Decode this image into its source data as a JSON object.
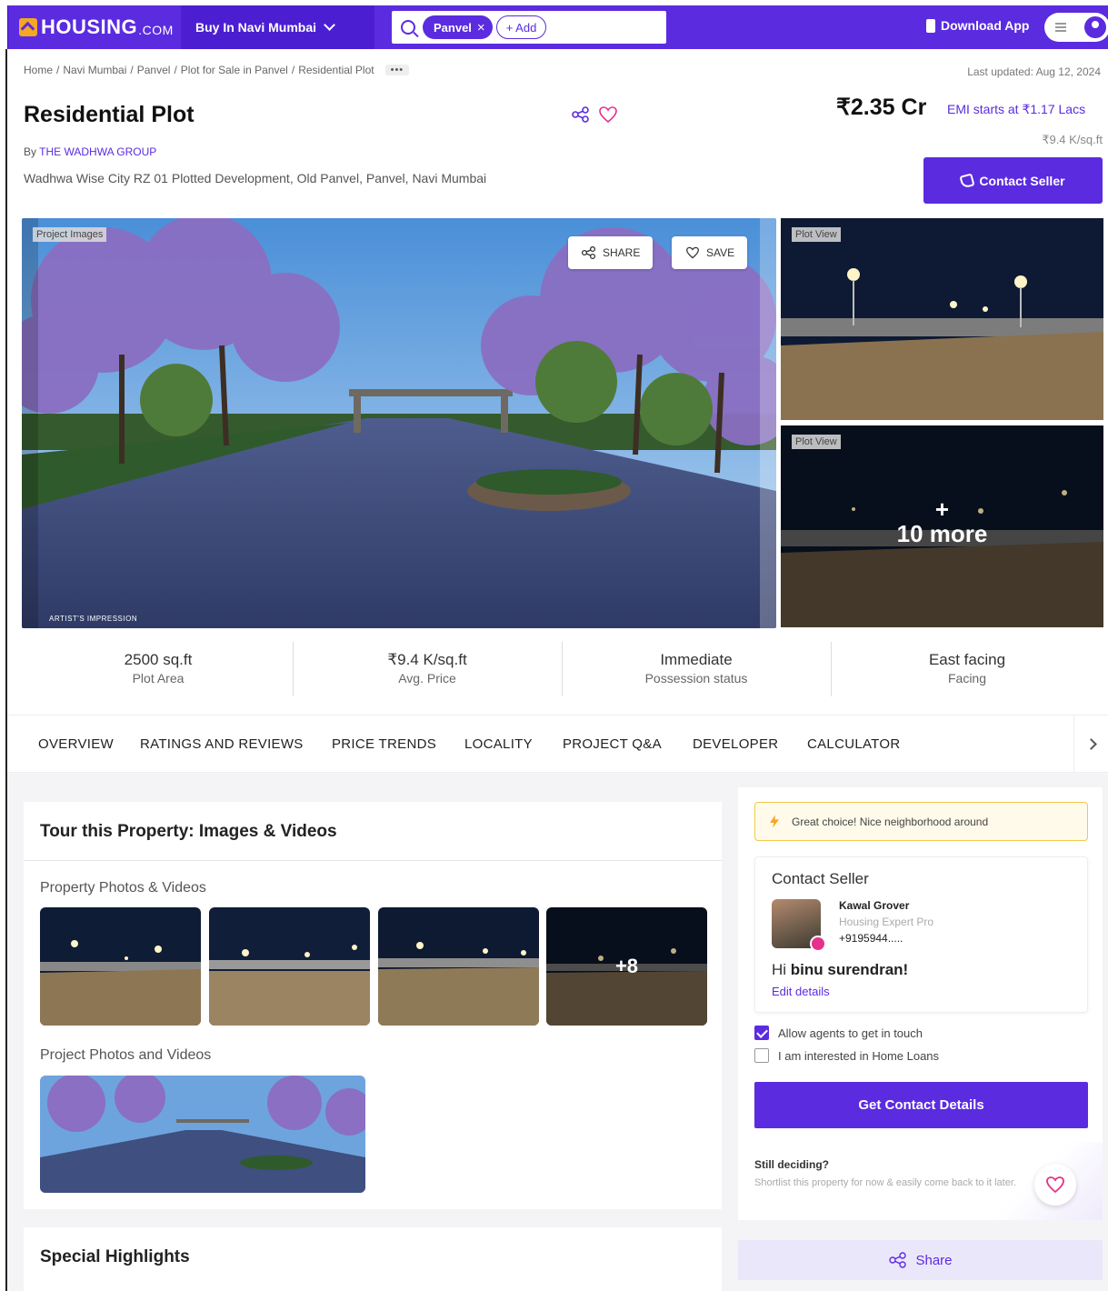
{
  "header": {
    "logo_text": "HOUSING",
    "logo_suffix": ".COM",
    "city_select": "Buy In Navi Mumbai",
    "search_chip": "Panvel",
    "add_chip": "+ Add",
    "download_app": "Download App"
  },
  "breadcrumb": {
    "items": [
      "Home",
      "Navi Mumbai",
      "Panvel",
      "Plot for Sale in Panvel",
      "Residential Plot"
    ],
    "more": "•••"
  },
  "last_updated": "Last updated: Aug 12, 2024",
  "listing": {
    "title": "Residential Plot",
    "by_prefix": "By",
    "developer": "THE WADHWA GROUP",
    "address": "Wadhwa Wise City RZ 01 Plotted Development, Old Panvel, Panvel, Navi Mumbai",
    "price": "₹2.35 Cr",
    "emi": "EMI starts at ₹1.17 Lacs",
    "price_per_sqft": "₹9.4 K/sq.ft",
    "contact_button": "Contact Seller"
  },
  "gallery": {
    "main_tag": "Project Images",
    "artist_note": "ARTIST'S IMPRESSION",
    "share": "SHARE",
    "save": "SAVE",
    "side1_tag": "Plot View",
    "side2_tag": "Plot View",
    "more_plus": "+",
    "more": "10 more"
  },
  "stats": [
    {
      "value": "2500 sq.ft",
      "label": "Plot Area"
    },
    {
      "value": "₹9.4 K/sq.ft",
      "label": "Avg. Price"
    },
    {
      "value": "Immediate",
      "label": "Possession status"
    },
    {
      "value": "East facing",
      "label": "Facing"
    }
  ],
  "tabs": [
    "OVERVIEW",
    "RATINGS AND REVIEWS",
    "PRICE TRENDS",
    "LOCALITY",
    "PROJECT Q&A",
    "DEVELOPER",
    "CALCULATOR"
  ],
  "tour": {
    "title": "Tour this Property: Images & Videos",
    "property_sub": "Property Photos & Videos",
    "more_count": "+8",
    "project_sub": "Project Photos and Videos"
  },
  "highlights_title": "Special Highlights",
  "sidebar": {
    "great_choice": "Great choice! Nice neighborhood around",
    "contact_title": "Contact Seller",
    "agent_name": "Kawal Grover",
    "agent_role": "Housing Expert Pro",
    "agent_phone": "+9195944.....",
    "hi_prefix": "Hi",
    "hi_name": "binu surendran!",
    "edit": "Edit details",
    "allow_agents": "Allow agents to get in touch",
    "home_loans": "I am interested in Home Loans",
    "get_details": "Get Contact Details",
    "still_title": "Still deciding?",
    "still_sub": "Shortlist this property for now & easily come back to it later.",
    "share": "Share"
  },
  "colors": {
    "brand": "#5b2be0",
    "accent": "#f5a623"
  }
}
